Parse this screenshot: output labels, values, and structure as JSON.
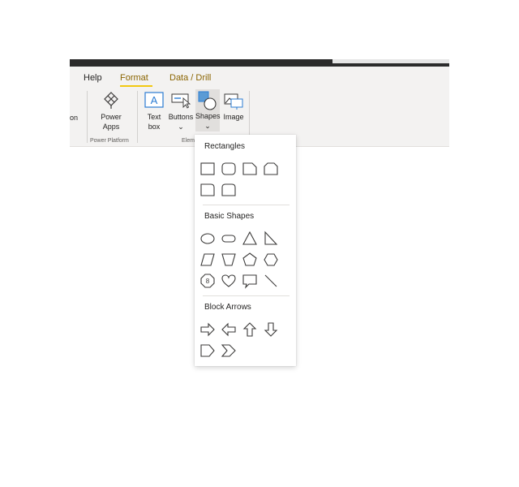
{
  "ribbon": {
    "tabs": [
      {
        "label": "Help",
        "active": false
      },
      {
        "label": "Format",
        "active": true
      },
      {
        "label": "Data / Drill",
        "active": true
      }
    ],
    "partial_left_label": "on",
    "power_apps": {
      "line1": "Power",
      "line2": "Apps",
      "icon": "power-apps-icon"
    },
    "group_power_platform": "Power Platform",
    "text_box": {
      "line1": "Text",
      "line2": "box",
      "icon": "text-box-icon"
    },
    "buttons": {
      "label": "Buttons",
      "chevron": "⌄",
      "icon": "buttons-icon"
    },
    "shapes": {
      "label": "Shapes",
      "chevron": "⌄",
      "icon": "shapes-icon"
    },
    "image": {
      "label": "Image",
      "icon": "image-icon"
    },
    "group_elements_partial": "Elem"
  },
  "dropdown": {
    "sections": [
      {
        "title": "Rectangles",
        "items": [
          "rectangle",
          "rounded-rectangle",
          "snipped-corner-rectangle",
          "snipped-top-rectangle",
          "top-rounded-rectangle",
          "rounded-rectangle-alt"
        ]
      },
      {
        "title": "Basic Shapes",
        "items": [
          "oval",
          "pill",
          "triangle",
          "right-triangle",
          "parallelogram",
          "trapezoid",
          "pentagon",
          "hexagon",
          "octagon",
          "heart",
          "speech-bubble",
          "line"
        ]
      },
      {
        "title": "Block Arrows",
        "items": [
          "right-arrow",
          "left-arrow",
          "up-arrow",
          "down-arrow",
          "pentagon-arrow",
          "chevron-arrow"
        ]
      }
    ],
    "octagon_text": "8"
  },
  "colors": {
    "accent_tab": "#8a6400",
    "tab_underline": "#f2c811",
    "shape_stroke": "#3b3a39",
    "icon_blue": "#2b7cd3"
  }
}
